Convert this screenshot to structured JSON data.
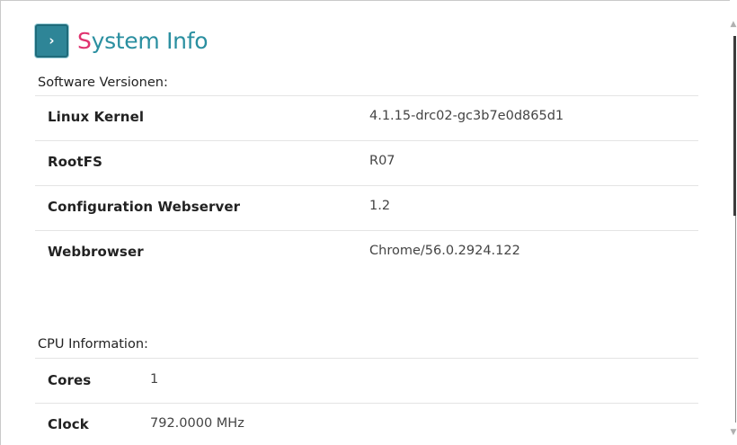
{
  "header": {
    "toggle_glyph": "›",
    "title_first": "S",
    "title_rest": "ystem Info"
  },
  "software": {
    "heading": "Software Versionen:",
    "rows": [
      {
        "label": "Linux Kernel",
        "value": "4.1.15-drc02-gc3b7e0d865d1"
      },
      {
        "label": "RootFS",
        "value": "R07"
      },
      {
        "label": "Configuration Webserver",
        "value": "1.2"
      },
      {
        "label": "Webbrowser",
        "value": "Chrome/56.0.2924.122"
      }
    ]
  },
  "cpu": {
    "heading": "CPU Information:",
    "rows": [
      {
        "label": "Cores",
        "value": "1"
      },
      {
        "label": "Clock",
        "value": "792.0000 MHz"
      }
    ]
  },
  "scrollbar": {
    "up_glyph": "▲",
    "down_glyph": "▼"
  },
  "colors": {
    "accent": "#2a8fa0",
    "title_first_letter": "#e0336f",
    "button_bg": "#2e8597"
  },
  "icons": {
    "toggle": "chevron-right-icon",
    "scroll_up": "scroll-up-arrow-icon",
    "scroll_down": "scroll-down-arrow-icon"
  }
}
